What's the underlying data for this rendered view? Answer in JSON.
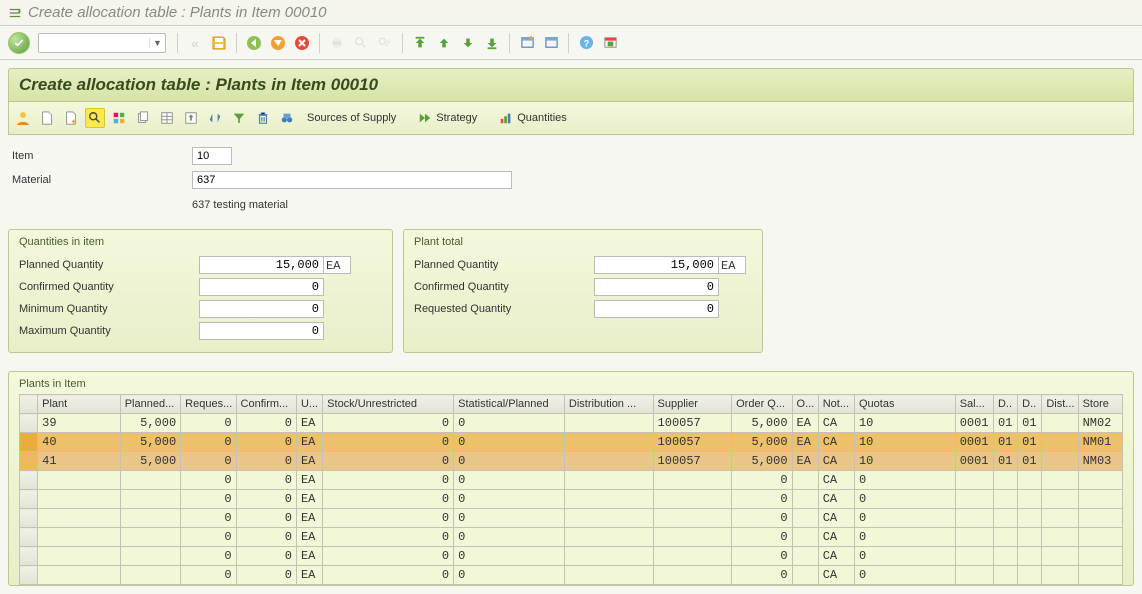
{
  "window_title": "Create allocation table : Plants in Item 00010",
  "page_title": "Create allocation table : Plants in Item 00010",
  "command_box": "",
  "app_toolbar": {
    "sources_of_supply": "Sources of Supply",
    "strategy": "Strategy",
    "quantities": "Quantities"
  },
  "form": {
    "item_label": "Item",
    "item_value": "10",
    "material_label": "Material",
    "material_value": "637",
    "material_desc": "637 testing material"
  },
  "qty_item": {
    "legend": "Quantities in item",
    "planned_label": "Planned Quantity",
    "planned_value": "15,000",
    "planned_unit": "EA",
    "confirmed_label": "Confirmed Quantity",
    "confirmed_value": "0",
    "min_label": "Minimum Quantity",
    "min_value": "0",
    "max_label": "Maximum Quantity",
    "max_value": "0"
  },
  "plant_total": {
    "legend": "Plant total",
    "planned_label": "Planned Quantity",
    "planned_value": "15,000",
    "planned_unit": "EA",
    "confirmed_label": "Confirmed Quantity",
    "confirmed_value": "0",
    "requested_label": "Requested Quantity",
    "requested_value": "0"
  },
  "grid": {
    "legend": "Plants in Item",
    "cols": {
      "plant": "Plant",
      "planned": "Planned...",
      "reques": "Reques...",
      "confirm": "Confirm...",
      "u": "U...",
      "stock": "Stock/Unrestricted",
      "stat": "Statistical/Planned",
      "distr": "Distribution ...",
      "supplier": "Supplier",
      "orderq": "Order Q...",
      "o": "O...",
      "not": "Not...",
      "quotas": "Quotas",
      "sal": "Sal...",
      "d1": "D..",
      "d2": "D..",
      "dist": "Dist...",
      "store": "Store"
    },
    "rows": [
      {
        "plant": "39",
        "planned": "5,000",
        "reques": "0",
        "confirm": "0",
        "u": "EA",
        "stock": "0",
        "stat": "0",
        "distr": "",
        "supplier": "100057",
        "orderq": "5,000",
        "o": "EA",
        "not": "CA",
        "quotas": "10",
        "sal": "0001",
        "d1": "01",
        "d2": "01",
        "dist": "",
        "store": "NM02",
        "cls": "data"
      },
      {
        "plant": "40",
        "planned": "5,000",
        "reques": "0",
        "confirm": "0",
        "u": "EA",
        "stock": "0",
        "stat": "0",
        "distr": "",
        "supplier": "100057",
        "orderq": "5,000",
        "o": "EA",
        "not": "CA",
        "quotas": "10",
        "sal": "0001",
        "d1": "01",
        "d2": "01",
        "dist": "",
        "store": "NM01",
        "cls": "hl1"
      },
      {
        "plant": "41",
        "planned": "5,000",
        "reques": "0",
        "confirm": "0",
        "u": "EA",
        "stock": "0",
        "stat": "0",
        "distr": "",
        "supplier": "100057",
        "orderq": "5,000",
        "o": "EA",
        "not": "CA",
        "quotas": "10",
        "sal": "0001",
        "d1": "01",
        "d2": "01",
        "dist": "",
        "store": "NM03",
        "cls": "hl2"
      }
    ],
    "empty_rows": 6,
    "empty_template": {
      "plant": "",
      "planned": "",
      "reques": "0",
      "confirm": "0",
      "u": "EA",
      "stock": "0",
      "stat": "0",
      "distr": "",
      "supplier": "",
      "orderq": "0",
      "o": "",
      "not": "CA",
      "quotas": "0",
      "sal": "",
      "d1": "",
      "d2": "",
      "dist": "",
      "store": ""
    }
  }
}
